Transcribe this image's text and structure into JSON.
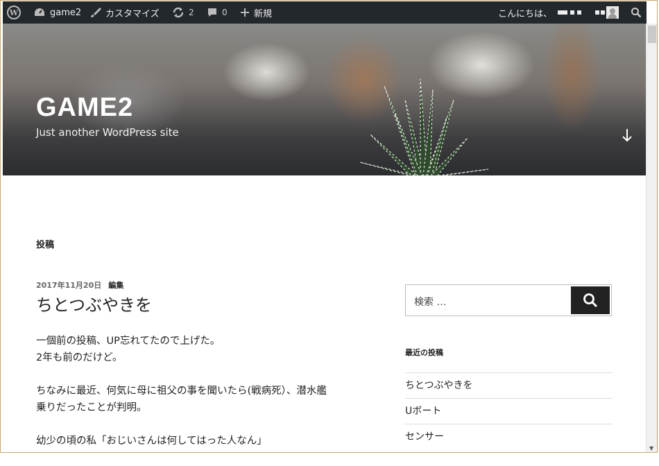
{
  "adminbar": {
    "site_name": "game2",
    "customize": "カスタマイズ",
    "updates_count": "2",
    "comments_count": "0",
    "new_label": "新規",
    "greeting": "こんにちは、"
  },
  "header": {
    "site_title": "GAME2",
    "tagline": "Just another WordPress site"
  },
  "main": {
    "page_heading": "投稿",
    "post": {
      "date": "2017年11月20日",
      "edit": "編集",
      "title": "ちとつぶやきを",
      "paragraphs": [
        [
          "一個前の投稿、UP忘れてたので上げた。",
          "2年も前のだけど。"
        ],
        [
          "ちなみに最近、何気に母に祖父の事を聞いたら(戦病死）、潜水艦",
          "乗りだったことが判明。"
        ],
        [
          "幼少の頃の私「おじいさんは何してはった人なん」"
        ]
      ]
    }
  },
  "sidebar": {
    "search_placeholder": "検索 …",
    "recent_title": "最近の投稿",
    "recent_posts": [
      "ちとつぶやきを",
      "Uボート",
      "センサー"
    ]
  }
}
